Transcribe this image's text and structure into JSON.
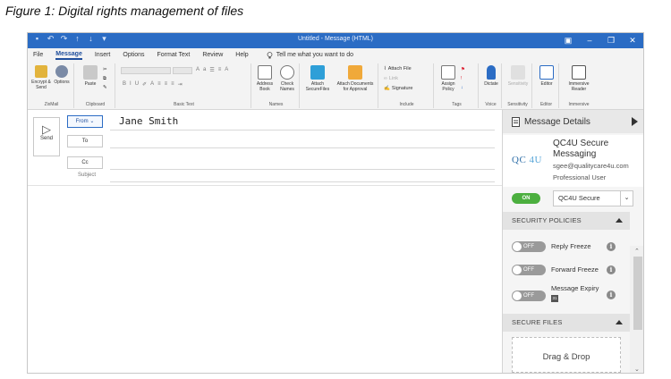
{
  "caption": "Figure 1: Digital rights management of files",
  "window": {
    "title": "Untitled - Message (HTML)",
    "controls": [
      "▣",
      "–",
      "❐",
      "✕"
    ]
  },
  "tabs": [
    "File",
    "Message",
    "Insert",
    "Options",
    "Format Text",
    "Review",
    "Help"
  ],
  "tell_me": "Tell me what you want to do",
  "ribbon": {
    "groups": [
      {
        "label": "ZixMail",
        "buttons": [
          "Encrypt & Send",
          "Options"
        ]
      },
      {
        "label": "Clipboard",
        "buttons": [
          "Paste"
        ]
      },
      {
        "label": "Basic Text",
        "buttons": []
      },
      {
        "label": "Names",
        "buttons": [
          "Address Book",
          "Check Names"
        ]
      },
      {
        "label": "",
        "buttons": [
          "Attach SecureFiles",
          "Attach Documents for Approval"
        ]
      },
      {
        "label": "Include",
        "buttons": [
          "Attach File",
          "Link",
          "Signature"
        ]
      },
      {
        "label": "Tags",
        "buttons": [
          "Assign Policy"
        ]
      },
      {
        "label": "Voice",
        "buttons": [
          "Dictate"
        ]
      },
      {
        "label": "Sensitivity",
        "buttons": [
          "Sensitivity"
        ]
      },
      {
        "label": "Editor",
        "buttons": [
          "Editor"
        ]
      },
      {
        "label": "Immersive",
        "buttons": [
          "Immersive Reader"
        ]
      }
    ]
  },
  "compose": {
    "send_label": "Send",
    "from_label": "From",
    "from_value": "Jane Smith",
    "to_label": "To",
    "cc_label": "Cc",
    "subject_label": "Subject"
  },
  "panel": {
    "header": "Message Details",
    "logo_main": "QC",
    "logo_accent": "4U",
    "product": "QC4U Secure Messaging",
    "email": "sgee@qualitycare4u.com",
    "role": "Professional User",
    "on_label": "ON",
    "profile": "QC4U Secure",
    "security_header": "SECURITY POLICIES",
    "policies": [
      {
        "label": "Reply Freeze",
        "state": "OFF"
      },
      {
        "label": "Forward Freeze",
        "state": "OFF"
      },
      {
        "label": "Message Expiry",
        "state": "OFF",
        "calendar": "31"
      }
    ],
    "files_header": "SECURE FILES",
    "drop_text": "Drag & Drop"
  }
}
